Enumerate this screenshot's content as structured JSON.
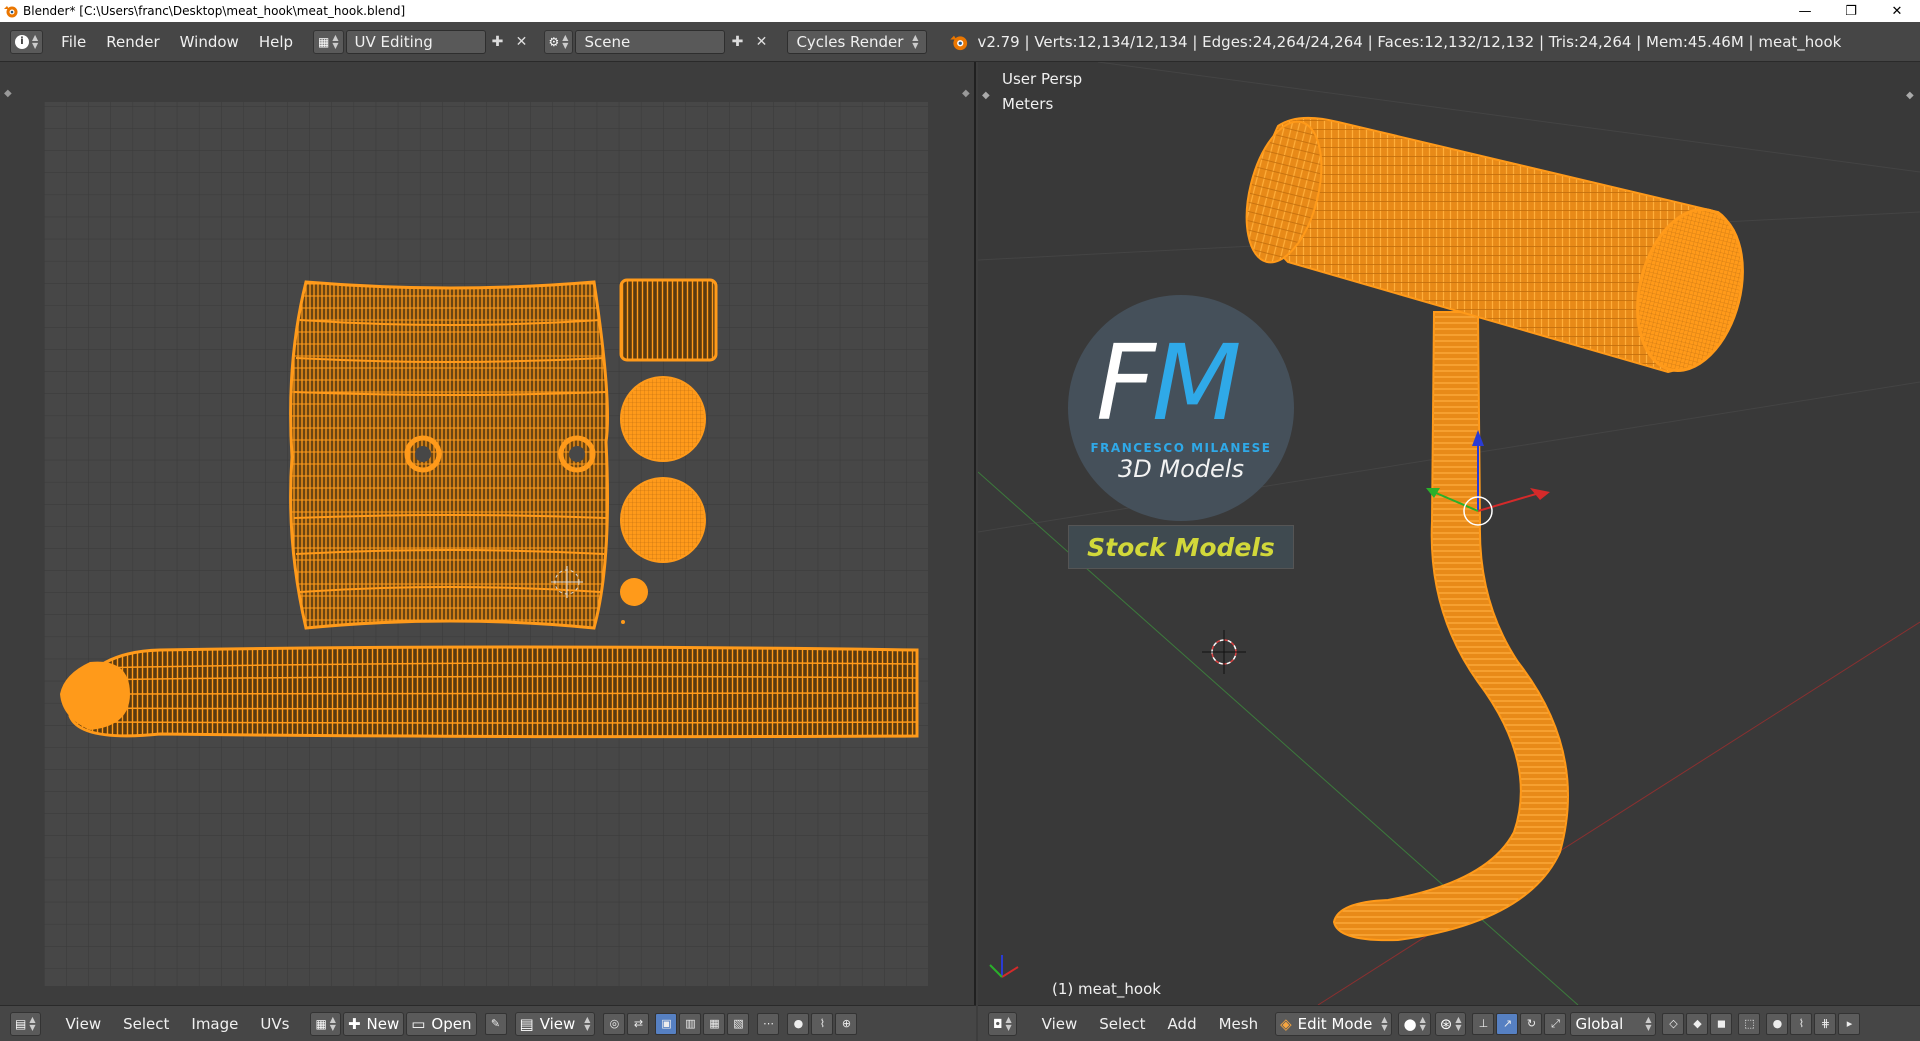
{
  "window": {
    "title": "Blender* [C:\\Users\\franc\\Desktop\\meat_hook\\meat_hook.blend]",
    "minimize": "—",
    "maximize": "❐",
    "close": "✕"
  },
  "menu": {
    "items": [
      "File",
      "Render",
      "Window",
      "Help"
    ]
  },
  "layout": {
    "screen_name": "UV Editing",
    "scene_name": "Scene",
    "render_engine": "Cycles Render"
  },
  "stats": "v2.79 | Verts:12,134/12,134 | Edges:24,264/24,264 | Faces:12,132/12,132 | Tris:24,264 | Mem:45.46M | meat_hook",
  "uv_editor": {
    "menu": [
      "View",
      "Select",
      "Image",
      "UVs"
    ],
    "new_label": "New",
    "open_label": "Open",
    "view_label": "View"
  },
  "viewport": {
    "view_name": "User Persp",
    "units": "Meters",
    "object_label": "(1) meat_hook",
    "menu": [
      "View",
      "Select",
      "Add",
      "Mesh"
    ],
    "mode": "Edit Mode",
    "orientation": "Global"
  },
  "logo": {
    "letter_f": "F",
    "letter_m": "M",
    "name": "FRANCESCO MILANESE",
    "sub": "3D Models",
    "stock": "Stock Models"
  },
  "colors": {
    "mesh_orange": "#ff9a1a",
    "background": "#3d3d3d",
    "header": "#464646",
    "logo_blue": "#2fa9e8",
    "stock_yellow": "#d2d83a"
  }
}
